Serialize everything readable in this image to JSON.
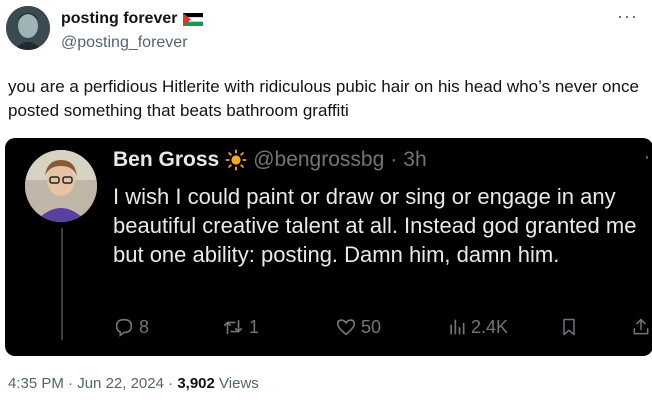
{
  "tweet": {
    "author_name": "posting forever",
    "author_handle": "@posting_forever",
    "text": "you are a perfidious Hitlerite with ridiculous pubic hair on his head who’s never once posted something that beats bathroom graffiti",
    "time": "4:35 PM",
    "date": "Jun 22, 2024",
    "separator": "·",
    "views_count": "3,902",
    "views_label": "Views",
    "more": "···"
  },
  "quote": {
    "author_name": "Ben Gross",
    "author_handle": "@bengrossbg",
    "separator": "·",
    "time": "3h",
    "text": "I wish I could paint or draw or sing or engage in any beautiful creative talent at all. Instead god granted me but one ability: posting. Damn him, damn him.",
    "more": "··",
    "actions": {
      "replies": "8",
      "reposts": "1",
      "likes": "50",
      "views": "2.4K"
    }
  },
  "colors": {
    "quote_bg": "#000000",
    "muted": "#536471",
    "quote_muted": "#71767b",
    "sun": "#f5a623"
  },
  "icons": [
    "palestine-flag-icon",
    "sun-icon",
    "reply-icon",
    "repost-icon",
    "like-icon",
    "views-icon",
    "bookmark-icon",
    "share-icon",
    "more-icon"
  ]
}
